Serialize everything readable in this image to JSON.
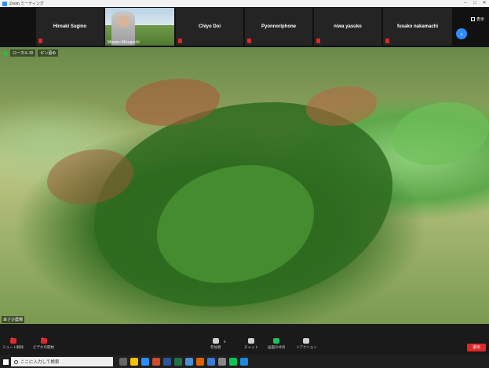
{
  "window": {
    "title": "Zoom ミーティング",
    "controls": [
      "–",
      "□",
      "✕"
    ]
  },
  "strip": {
    "participants": [
      {
        "name": "Hiroaki Sugino",
        "muted": true,
        "video": false
      },
      {
        "name": "Masaru Mizoguchi",
        "muted": false,
        "video": true
      },
      {
        "name": "Chiyo Doi",
        "muted": true,
        "video": false
      },
      {
        "name": "Pyonnoriphone",
        "muted": true,
        "video": false
      },
      {
        "name": "niwa yasuko",
        "muted": true,
        "video": false
      },
      {
        "name": "fusako nakamachi",
        "muted": true,
        "video": false
      }
    ],
    "view_label": "表示",
    "next_arrow": "›"
  },
  "main": {
    "security_label": "ローカル ID",
    "status_badge": "ピン留め",
    "speaker_label": "あさひ農場"
  },
  "controls": {
    "mute": "ミュート解除",
    "video": "ビデオの開始",
    "participants": "参加者",
    "participants_count": "6",
    "chat": "チャット",
    "share": "画面の共有",
    "reactions": "リアクション",
    "end": "退出"
  },
  "taskbar": {
    "search_placeholder": "ここに入力して検索",
    "app_icons": [
      "task-view-icon",
      "file-explorer-icon",
      "zoom-app-icon",
      "edge-icon",
      "word-icon",
      "excel-icon",
      "calendar-icon",
      "firefox-icon",
      "mail-icon",
      "store-icon",
      "line-icon",
      "photos-icon"
    ]
  },
  "colors": {
    "accent": "#2d8cff",
    "end": "#e02828",
    "share": "#20c05a"
  }
}
